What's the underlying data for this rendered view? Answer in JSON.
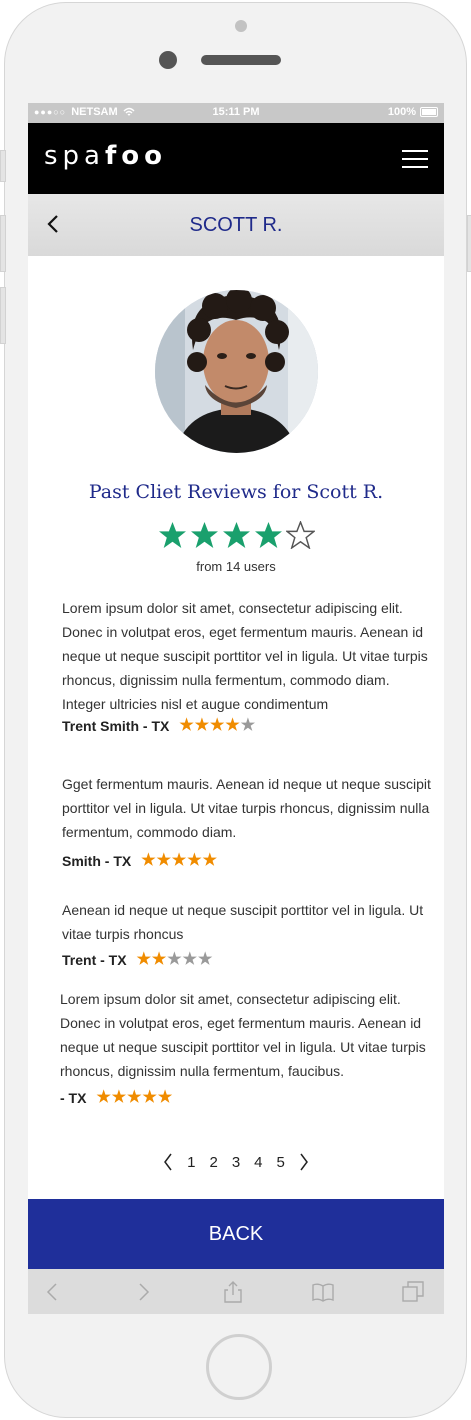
{
  "status_bar": {
    "carrier": "NETSAM",
    "time": "15:11 PM",
    "battery": "100%"
  },
  "app": {
    "logo_light": "spa",
    "logo_bold": "foo"
  },
  "page": {
    "title": "SCOTT R.",
    "heading": "Past Cliet Reviews for Scott R.",
    "overall_rating": 4,
    "rating_count_text": "from 14 users"
  },
  "reviews": [
    {
      "text": "Lorem ipsum dolor sit amet, consectetur adipiscing elit. Donec in volutpat eros, eget fermentum mauris. Aenean id neque ut neque suscipit porttitor vel in ligula. Ut vitae turpis rhoncus, dignissim nulla fermentum, commodo diam. Integer ultricies nisl et augue condimentum",
      "author": "Trent Smith - TX",
      "rating": 4
    },
    {
      "text": "Gget fermentum mauris. Aenean id neque ut neque suscipit porttitor vel in ligula. Ut vitae turpis rhoncus, dignissim nulla fermentum, commodo diam.",
      "author": "Smith - TX",
      "rating": 5
    },
    {
      "text": "Aenean id neque ut neque suscipit porttitor vel in ligula. Ut vitae turpis rhoncus",
      "author": "Trent - TX",
      "rating": 2
    },
    {
      "text": "Lorem ipsum dolor sit amet, consectetur adipiscing elit. Donec in volutpat eros, eget fermentum mauris. Aenean id neque ut neque suscipit porttitor vel in ligula. Ut vitae turpis rhoncus, dignissim nulla fermentum, faucibus.",
      "author": "- TX",
      "rating": 5
    }
  ],
  "pagination": {
    "pages": [
      "1",
      "2",
      "3",
      "4",
      "5"
    ]
  },
  "back_button": {
    "label": "BACK"
  },
  "colors": {
    "accent": "#1f2a8a",
    "back_bar": "#1f2f9a",
    "star_green": "#1aa06d",
    "star_orange": "#f08c00"
  },
  "icons": {
    "menu": "hamburger-menu-icon",
    "back": "chevron-left-icon",
    "browser_back": "chevron-left-icon",
    "browser_forward": "chevron-right-icon",
    "share": "share-icon",
    "bookmarks": "book-icon",
    "tabs": "tabs-icon"
  }
}
